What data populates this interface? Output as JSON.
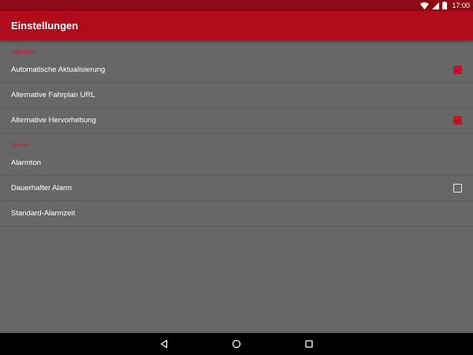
{
  "status_bar": {
    "time": "17:00",
    "icons": [
      "wifi-icon",
      "cell-signal-icon",
      "battery-icon"
    ]
  },
  "app_bar": {
    "title": "Einstellungen"
  },
  "categories": [
    {
      "title": "Allgemein",
      "items": [
        {
          "label": "Automatische Aktualisierung",
          "checkbox": true,
          "checked": true
        },
        {
          "label": "Alternative Fahrplan URL",
          "checkbox": false
        },
        {
          "label": "Alternative Hervorhebung",
          "checkbox": true,
          "checked": true
        }
      ]
    },
    {
      "title": "Alarme",
      "items": [
        {
          "label": "Alarmton",
          "checkbox": false
        },
        {
          "label": "Dauerhafter Alarm",
          "checkbox": true,
          "checked": false
        },
        {
          "label": "Standard-Alarmzeit",
          "checkbox": false
        }
      ]
    }
  ],
  "nav_bar": {
    "icons": [
      "back-icon",
      "home-icon",
      "recents-icon"
    ]
  },
  "colors": {
    "status_bar": "#8c0a14",
    "app_bar": "#b00b1b",
    "accent": "#d0101e",
    "background": "#676767"
  }
}
